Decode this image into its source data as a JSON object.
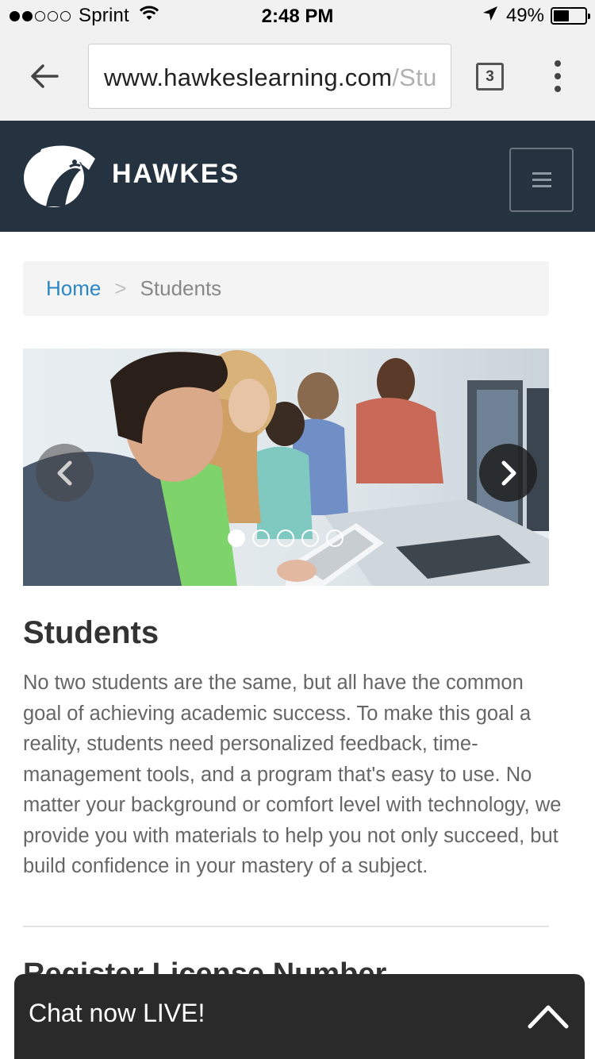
{
  "status_bar": {
    "carrier": "Sprint",
    "signal_bars_filled": 2,
    "signal_bars_total": 5,
    "time": "2:48 PM",
    "battery_percent": "49%",
    "battery_level": 0.49
  },
  "browser": {
    "url_host": "www.hawkeslearning.com",
    "url_path": "/Stu",
    "tab_count": "3"
  },
  "header": {
    "brand": "HAWKES",
    "colors": {
      "background": "#253341",
      "text": "#ffffff"
    }
  },
  "breadcrumb": {
    "home": "Home",
    "separator": ">",
    "current": "Students"
  },
  "carousel": {
    "slide_count": 5,
    "active_index": 0
  },
  "content": {
    "title": "Students",
    "body": "No two students are the same, but all have the common goal of achieving academic success. To make this goal a reality, students need personalized feedback, time-management tools, and a program that's easy to use. No matter your background or comfort level with technology, we provide you with materials to help you not only succeed, but build confidence in your mastery of a subject.",
    "next_heading": "Register License Number"
  },
  "chat": {
    "label": "Chat now LIVE!"
  },
  "colors": {
    "link": "#2a87c4",
    "chat_background": "#2a2a2a"
  }
}
